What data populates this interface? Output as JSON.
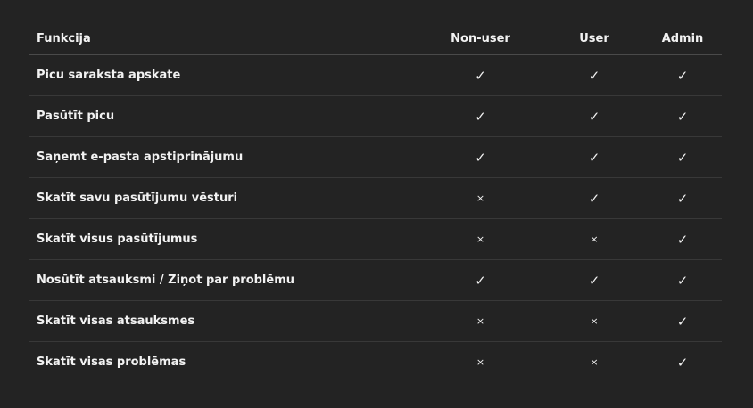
{
  "headers": {
    "function": "Funkcija",
    "nonuser": "Non-user",
    "user": "User",
    "admin": "Admin"
  },
  "symbols": {
    "check": "✓",
    "cross": "×"
  },
  "rows": [
    {
      "label": "Picu saraksta apskate",
      "nonuser": "✓",
      "user": "✓",
      "admin": "✓"
    },
    {
      "label": "Pasūtīt picu",
      "nonuser": "✓",
      "user": "✓",
      "admin": "✓"
    },
    {
      "label": "Saņemt e-pasta apstiprinājumu",
      "nonuser": "✓",
      "user": "✓",
      "admin": "✓"
    },
    {
      "label": "Skatīt savu pasūtījumu vēsturi",
      "nonuser": "×",
      "user": "✓",
      "admin": "✓"
    },
    {
      "label": "Skatīt visus pasūtījumus",
      "nonuser": "×",
      "user": "×",
      "admin": "✓"
    },
    {
      "label": "Nosūtīt atsauksmi / Ziņot par problēmu",
      "nonuser": "✓",
      "user": "✓",
      "admin": "✓"
    },
    {
      "label": "Skatīt visas atsauksmes",
      "nonuser": "×",
      "user": "×",
      "admin": "✓"
    },
    {
      "label": "Skatīt visas problēmas",
      "nonuser": "×",
      "user": "×",
      "admin": "✓"
    }
  ]
}
